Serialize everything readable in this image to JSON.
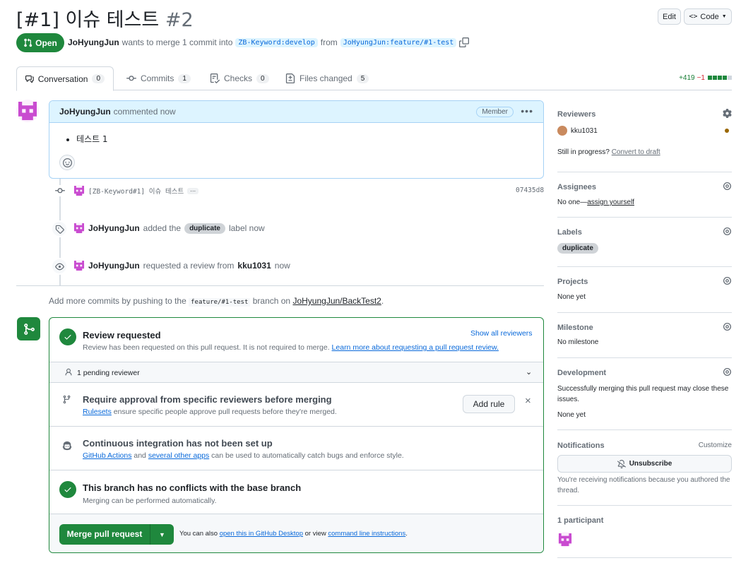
{
  "header": {
    "title": "[#1] 이슈 테스트",
    "number": "#2",
    "edit_label": "Edit",
    "code_label": "Code"
  },
  "pr_meta": {
    "state": "Open",
    "author": "JoHyungJun",
    "action_text": "wants to merge 1 commit into",
    "base_branch": "ZB-Keyword:develop",
    "from_text": "from",
    "head_branch": "JoHyungJun:feature/#1-test"
  },
  "tabs": [
    {
      "label": "Conversation",
      "count": "0"
    },
    {
      "label": "Commits",
      "count": "1"
    },
    {
      "label": "Checks",
      "count": "0"
    },
    {
      "label": "Files changed",
      "count": "5"
    }
  ],
  "diffstat": {
    "additions": "+419",
    "deletions": "−1"
  },
  "comment": {
    "author": "JoHyungJun",
    "action": "commented now",
    "badge": "Member",
    "body_item": "테스트 1"
  },
  "timeline": {
    "commit": {
      "message": "[ZB-Keyword#1] 이슈 테스트",
      "sha": "07435d8"
    },
    "labeled": {
      "actor": "JoHyungJun",
      "before": "added the",
      "label": "duplicate",
      "after": "label now"
    },
    "review_request": {
      "actor": "JoHyungJun",
      "before": "requested a review from",
      "reviewer": "kku1031",
      "after": "now"
    }
  },
  "push_info": {
    "prefix": "Add more commits by pushing to the",
    "branch": "feature/#1-test",
    "middle": "branch on",
    "repo": "JoHyungJun/BackTest2",
    "suffix": "."
  },
  "merge_box": {
    "review": {
      "title": "Review requested",
      "show_all": "Show all reviewers",
      "desc": "Review has been requested on this pull request. It is not required to merge.",
      "learn_more": "Learn more about requesting a pull request review."
    },
    "pending": "1 pending reviewer",
    "approval": {
      "title": "Require approval from specific reviewers before merging",
      "rulesets": "Rulesets",
      "desc": "ensure specific people approve pull requests before they're merged.",
      "add_rule": "Add rule"
    },
    "ci": {
      "title": "Continuous integration has not been set up",
      "gh_actions": "GitHub Actions",
      "and": "and",
      "several": "several other apps",
      "desc": "can be used to automatically catch bugs and enforce style."
    },
    "conflicts": {
      "title": "This branch has no conflicts with the base branch",
      "desc": "Merging can be performed automatically."
    },
    "merge_button": "Merge pull request",
    "also_text": "You can also",
    "desktop_link": "open this in GitHub Desktop",
    "or_view": "or view",
    "cli_link": "command line instructions",
    "period": "."
  },
  "sidebar": {
    "reviewers": {
      "heading": "Reviewers",
      "name": "kku1031",
      "in_progress": "Still in progress?",
      "convert": "Convert to draft"
    },
    "assignees": {
      "heading": "Assignees",
      "none": "No one—",
      "assign": "assign yourself"
    },
    "labels": {
      "heading": "Labels",
      "label": "duplicate"
    },
    "projects": {
      "heading": "Projects",
      "value": "None yet"
    },
    "milestone": {
      "heading": "Milestone",
      "value": "No milestone"
    },
    "development": {
      "heading": "Development",
      "desc": "Successfully merging this pull request may close these issues.",
      "value": "None yet"
    },
    "notifications": {
      "heading": "Notifications",
      "customize": "Customize",
      "unsubscribe": "Unsubscribe",
      "reason": "You're receiving notifications because you authored the thread."
    },
    "participants": {
      "heading": "1 participant"
    }
  },
  "colors": {
    "accent_green": "#1f883d",
    "link_blue": "#0969da",
    "avatar_magenta": "#c94bd0"
  }
}
